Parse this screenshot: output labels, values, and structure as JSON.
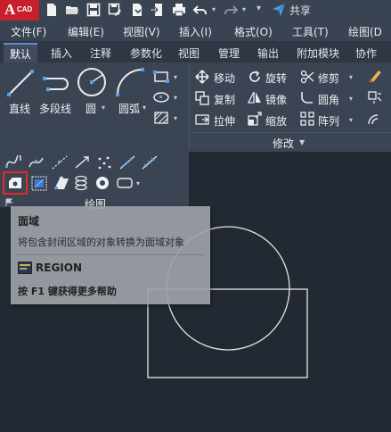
{
  "app": {
    "logo_letter": "A",
    "logo_suffix": "CAD"
  },
  "quick_access": {
    "share_label": "共享",
    "icons": [
      "new-file-icon",
      "open-folder-icon",
      "save-icon",
      "save-as-icon",
      "open-web-icon",
      "save-web-icon",
      "print-icon",
      "undo-icon",
      "redo-icon",
      "dropdown-icon",
      "share-icon"
    ]
  },
  "menu": {
    "items": [
      "文件(F)",
      "编辑(E)",
      "视图(V)",
      "插入(I)",
      "格式(O)",
      "工具(T)",
      "绘图(D"
    ]
  },
  "ribbon_tabs": [
    "默认",
    "插入",
    "注释",
    "参数化",
    "视图",
    "管理",
    "输出",
    "附加模块",
    "协作"
  ],
  "draw_panel": {
    "line_label": "直线",
    "polyline_label": "多段线",
    "circle_label": "圆",
    "arc_label": "圆弧",
    "panel_title": "绘图",
    "title_caret": "▼"
  },
  "modify_panel": {
    "move_label": "移动",
    "rotate_label": "旋转",
    "trim_label": "修剪",
    "copy_label": "复制",
    "mirror_label": "镜像",
    "fillet_label": "圆角",
    "stretch_label": "拉伸",
    "scale_label": "缩放",
    "array_label": "阵列",
    "panel_title": "修改",
    "title_caret": "▼"
  },
  "tooltip": {
    "title": "面域",
    "description": "将包含封闭区域的对象转换为面域对象",
    "command": "REGION",
    "help": "按 F1 键获得更多帮助"
  },
  "colors": {
    "ribbon_bg": "#3b4453",
    "canvas_bg": "#222933",
    "highlight": "#e32a2a",
    "share_icon": "#4b9fe8",
    "accent_tab": "#5b8fd6"
  }
}
